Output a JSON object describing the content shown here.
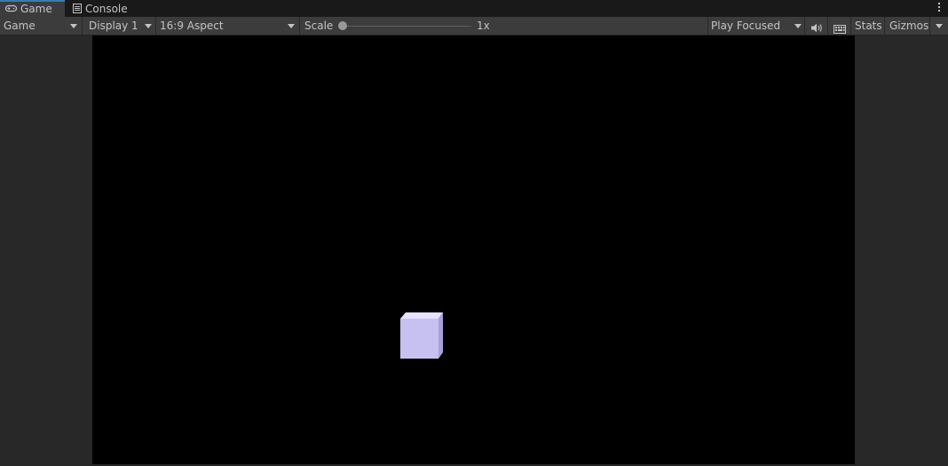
{
  "tabs": [
    {
      "label": "Game",
      "icon": "gamepad-icon",
      "active": true
    },
    {
      "label": "Console",
      "icon": "console-icon",
      "active": false
    }
  ],
  "toolbar": {
    "game_dropdown": "Game",
    "display_dropdown": "Display 1",
    "aspect_dropdown": "16:9 Aspect",
    "scale_label": "Scale",
    "scale_value": "1x",
    "scale_slider_position": 0,
    "play_mode_dropdown": "Play Focused",
    "audio_icon": "speaker-icon",
    "stats_grid_icon": "keyboard-icon",
    "stats_label": "Stats",
    "gizmos_label": "Gizmos"
  },
  "colors": {
    "tab_bar": "#191919",
    "toolbar": "#3c3c3c",
    "active_tab_accent": "#3a79bb",
    "letterbox": "#282828",
    "viewport": "#000000",
    "cube_front": "#c7c1f2",
    "cube_top": "#e6e2ff",
    "cube_side": "#a9a2d8"
  }
}
